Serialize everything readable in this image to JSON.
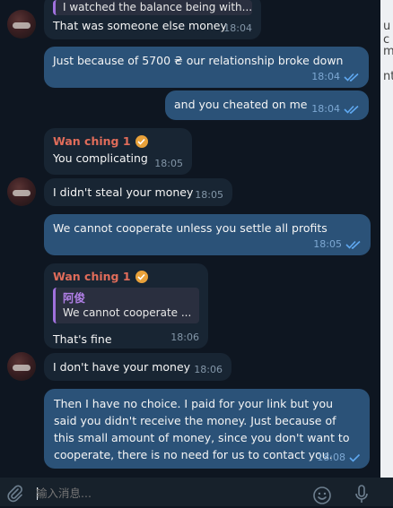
{
  "colors": {
    "background": "#0e1621",
    "incoming_bubble": "#182533",
    "outgoing_bubble": "#2b5278",
    "sender_name": "#e06c5a",
    "reply_accent": "#a071dd",
    "read_checks": "#5fa8f0"
  },
  "messages": [
    {
      "id": "m1",
      "direction": "incoming",
      "quote_text": "I watched the balance being with...",
      "text": "That was someone else money",
      "time": "18:04"
    },
    {
      "id": "m2",
      "direction": "outgoing",
      "text": "Just because of 5700 ₴ our relationship broke down",
      "time": "18:04",
      "status_icon": "double-check-icon"
    },
    {
      "id": "m3",
      "direction": "outgoing",
      "text": "and you cheated on me",
      "time": "18:04",
      "status_icon": "double-check-icon"
    },
    {
      "id": "m4",
      "direction": "incoming",
      "sender": "Wan ching 1",
      "text": "You complicating",
      "time": "18:05"
    },
    {
      "id": "m5",
      "direction": "incoming",
      "text": "I didn't steal your money",
      "time": "18:05"
    },
    {
      "id": "m6",
      "direction": "outgoing",
      "text": "We cannot cooperate unless you settle all profits",
      "time": "18:05",
      "status_icon": "double-check-icon"
    },
    {
      "id": "m7",
      "direction": "incoming",
      "sender": "Wan ching 1",
      "reply_name": "阿俊",
      "reply_text": "We cannot cooperate ...",
      "text": "That's fine",
      "time": "18:06"
    },
    {
      "id": "m8",
      "direction": "incoming",
      "text": "I don't have your money",
      "time": "18:06"
    },
    {
      "id": "m9",
      "direction": "outgoing",
      "text": "Then I have no choice. I paid for your link but you said you didn't receive the money. Just because of this small amount of money, since you don't want to cooperate, there is no need for us to contact you.",
      "time": "18:08",
      "status_icon": "single-check-icon"
    }
  ],
  "composer": {
    "placeholder": "输入消息..."
  },
  "edge_fragments": [
    "u c",
    "m",
    "nt"
  ]
}
